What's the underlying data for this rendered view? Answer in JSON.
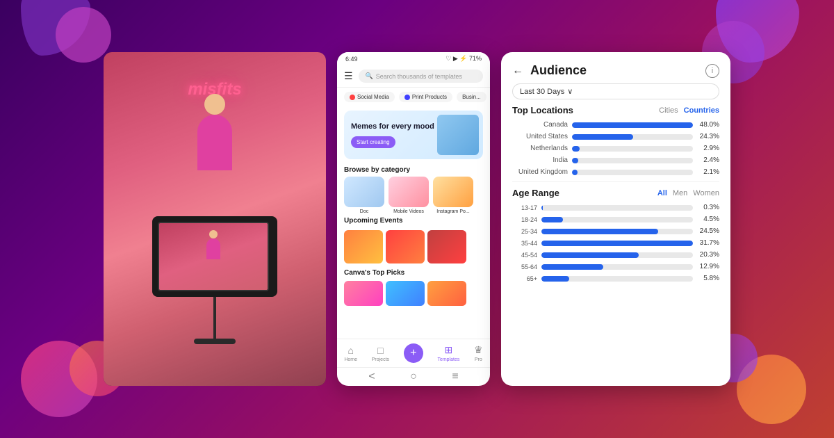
{
  "background": {
    "gradient": "linear-gradient(135deg, #3a0060 0%, #6b0080 30%, #9b1060 60%, #c04030 100%)"
  },
  "camera_panel": {
    "neon_text": "misfits"
  },
  "mobile_panel": {
    "status_bar": {
      "time": "6:49",
      "icons": "♡ ▶ ⚡",
      "battery": "71%"
    },
    "search_placeholder": "Search thousands of templates",
    "categories": [
      {
        "label": "Social Media",
        "icon": "🔴"
      },
      {
        "label": "Print Products",
        "icon": "🔵"
      },
      {
        "label": "Busin...",
        "icon": ""
      }
    ],
    "banner": {
      "heading": "Memes for every mood",
      "cta": "Start creating"
    },
    "browse_title": "Browse by category",
    "browse_items": [
      {
        "label": "Doc"
      },
      {
        "label": "Mobile Videos"
      },
      {
        "label": "Instagram Po..."
      }
    ],
    "events_title": "Upcoming Events",
    "toppicks_title": "Canva's Top Picks",
    "bottom_nav": [
      {
        "label": "Home",
        "icon": "⌂",
        "active": false
      },
      {
        "label": "Projects",
        "icon": "□",
        "active": false
      },
      {
        "label": "+",
        "icon": "+",
        "active": false,
        "fab": true
      },
      {
        "label": "Templates",
        "icon": "⊞",
        "active": true
      },
      {
        "label": "Pro",
        "icon": "♛",
        "active": false
      }
    ],
    "nav_bottom": [
      "<",
      "○",
      "≡"
    ]
  },
  "audience_panel": {
    "back_label": "←",
    "title": "Audience",
    "info_icon": "i",
    "date_filter": "Last 30 Days",
    "date_caret": "∨",
    "top_locations_label": "Top Locations",
    "tab_cities": "Cities",
    "tab_countries": "Countries",
    "locations": [
      {
        "country": "Canada",
        "value": "48.0%",
        "pct": 48
      },
      {
        "country": "United States",
        "value": "24.3%",
        "pct": 24.3
      },
      {
        "country": "Netherlands",
        "value": "2.9%",
        "pct": 2.9
      },
      {
        "country": "India",
        "value": "2.4%",
        "pct": 2.4
      },
      {
        "country": "United Kingdom",
        "value": "2.1%",
        "pct": 2.1
      }
    ],
    "age_range_label": "Age Range",
    "age_tab_all": "All",
    "age_tab_men": "Men",
    "age_tab_women": "Women",
    "ages": [
      {
        "range": "13-17",
        "value": "0.3%",
        "pct": 0.3
      },
      {
        "range": "18-24",
        "value": "4.5%",
        "pct": 4.5
      },
      {
        "range": "25-34",
        "value": "24.5%",
        "pct": 24.5
      },
      {
        "range": "35-44",
        "value": "31.7%",
        "pct": 31.7
      },
      {
        "range": "45-54",
        "value": "20.3%",
        "pct": 20.3
      },
      {
        "range": "55-64",
        "value": "12.9%",
        "pct": 12.9
      },
      {
        "range": "65+",
        "value": "5.8%",
        "pct": 5.8
      }
    ]
  }
}
